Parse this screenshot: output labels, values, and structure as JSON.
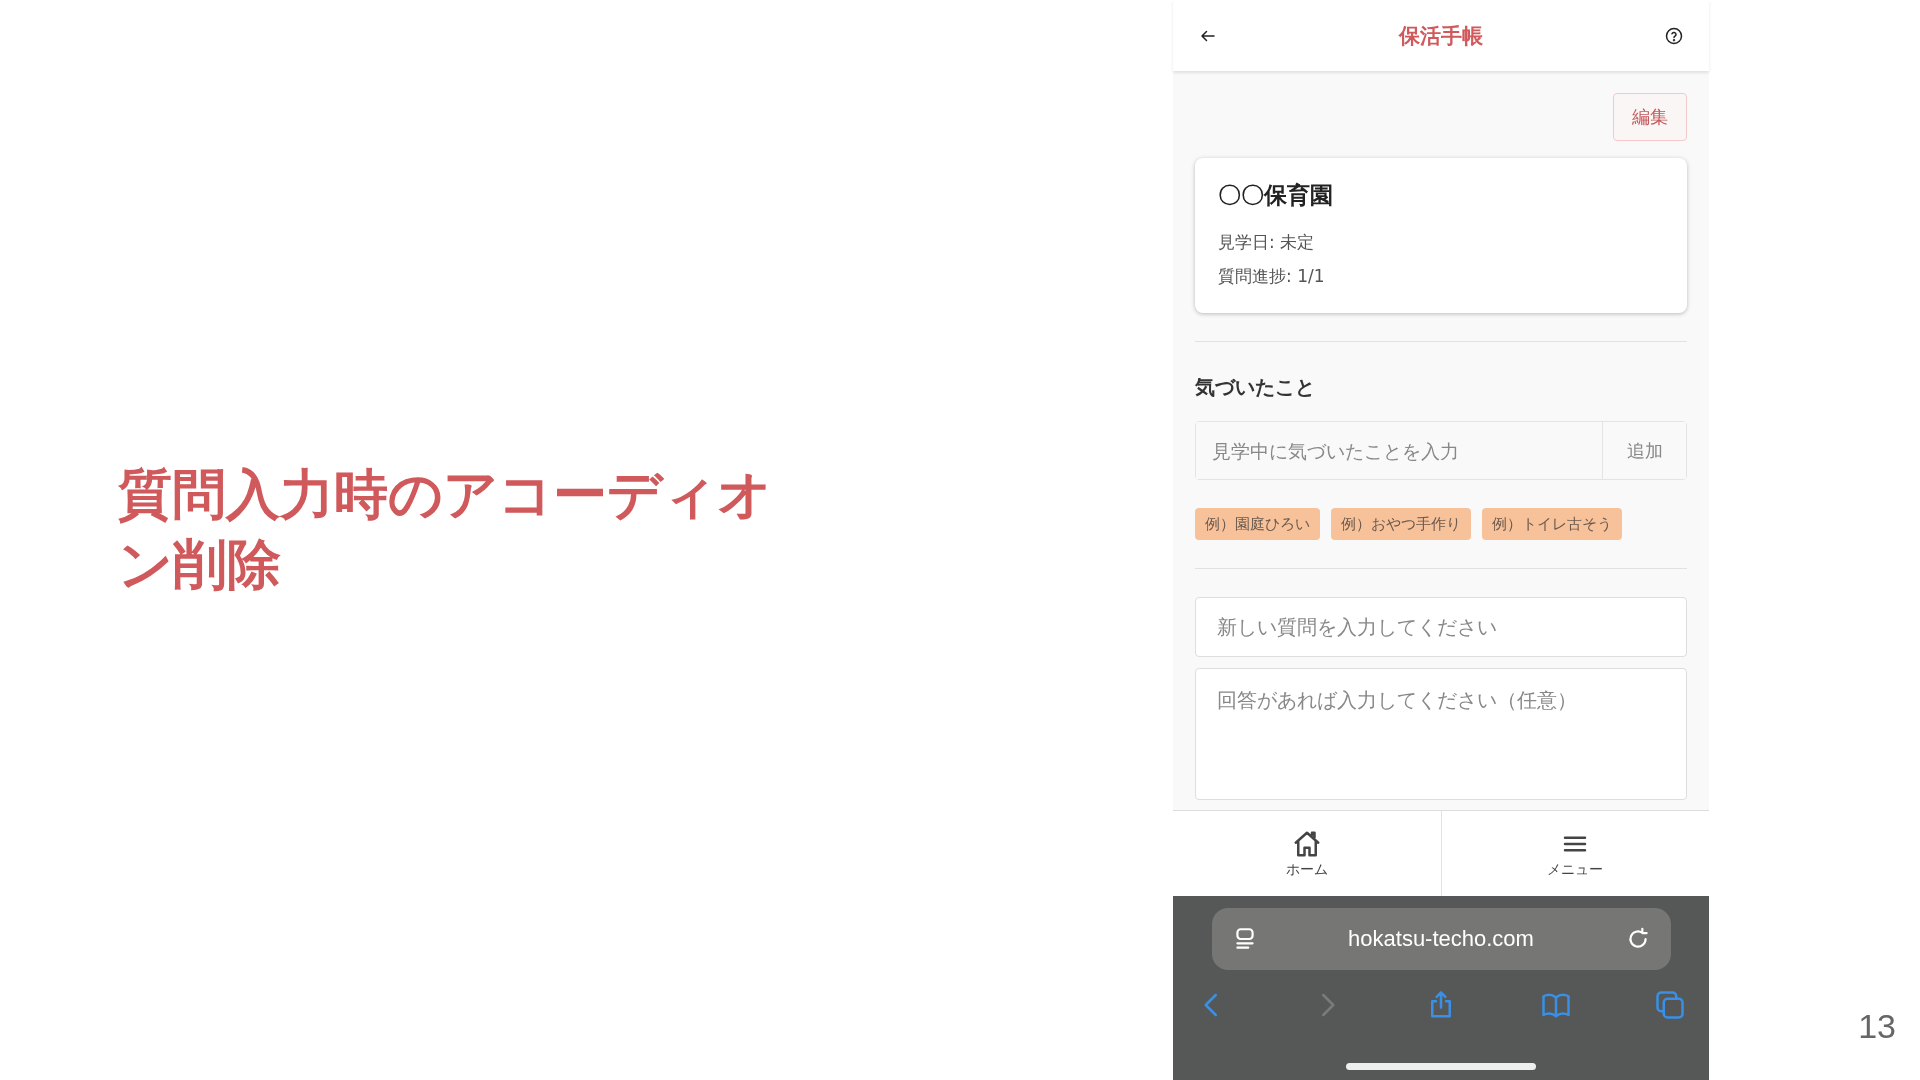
{
  "slide": {
    "title": "質問入力時のアコーディオン削除",
    "page_number": "13"
  },
  "app": {
    "header": {
      "title": "保活手帳"
    },
    "edit_button": "編集",
    "card": {
      "name": "〇〇保育園",
      "details": [
        "見学日: 未定",
        "質問進捗: 1/1"
      ]
    },
    "notes": {
      "heading": "気づいたこと",
      "placeholder": "見学中に気づいたことを入力",
      "add_button": "追加",
      "chips": [
        "例）園庭ひろい",
        "例）おやつ手作り",
        "例）トイレ古そう"
      ]
    },
    "question": {
      "placeholder": "新しい質問を入力してください"
    },
    "answer": {
      "placeholder": "回答があれば入力してください（任意）"
    },
    "bottom_nav": [
      {
        "kind": "home",
        "label": "ホーム"
      },
      {
        "kind": "menu",
        "label": "メニュー"
      }
    ]
  },
  "browser": {
    "url": "hokatsu-techo.com",
    "toolbar": [
      {
        "kind": "back",
        "disabled": false
      },
      {
        "kind": "forward",
        "disabled": true
      },
      {
        "kind": "share",
        "disabled": false
      },
      {
        "kind": "bookmarks",
        "disabled": false
      },
      {
        "kind": "tabs",
        "disabled": false
      }
    ]
  }
}
